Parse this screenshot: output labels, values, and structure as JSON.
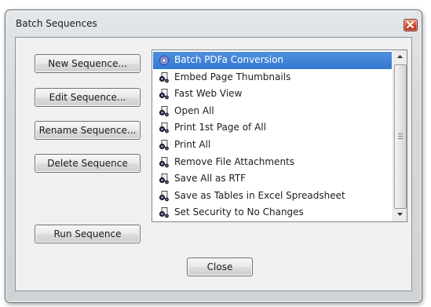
{
  "window": {
    "title": "Batch Sequences"
  },
  "buttons": {
    "new_sequence": "New Sequence...",
    "edit_sequence": "Edit Sequence...",
    "rename_sequence": "Rename Sequence...",
    "delete_sequence": "Delete Sequence",
    "run_sequence": "Run Sequence",
    "close": "Close"
  },
  "sequences": {
    "selected_index": 0,
    "items": [
      {
        "label": "Batch PDFa Conversion",
        "icon": "gear-sequence-icon"
      },
      {
        "label": "Embed Page Thumbnails",
        "icon": "sequence-icon"
      },
      {
        "label": "Fast Web View",
        "icon": "sequence-icon"
      },
      {
        "label": "Open All",
        "icon": "sequence-icon"
      },
      {
        "label": "Print 1st Page of All",
        "icon": "sequence-icon"
      },
      {
        "label": "Print All",
        "icon": "sequence-icon"
      },
      {
        "label": "Remove File Attachments",
        "icon": "sequence-icon"
      },
      {
        "label": "Save All as RTF",
        "icon": "sequence-icon"
      },
      {
        "label": "Save as Tables in Excel Spreadsheet",
        "icon": "sequence-icon"
      },
      {
        "label": "Set Security to No Changes",
        "icon": "sequence-icon"
      }
    ]
  },
  "colors": {
    "selection": "#3478d2",
    "close_button": "#d0452a"
  }
}
